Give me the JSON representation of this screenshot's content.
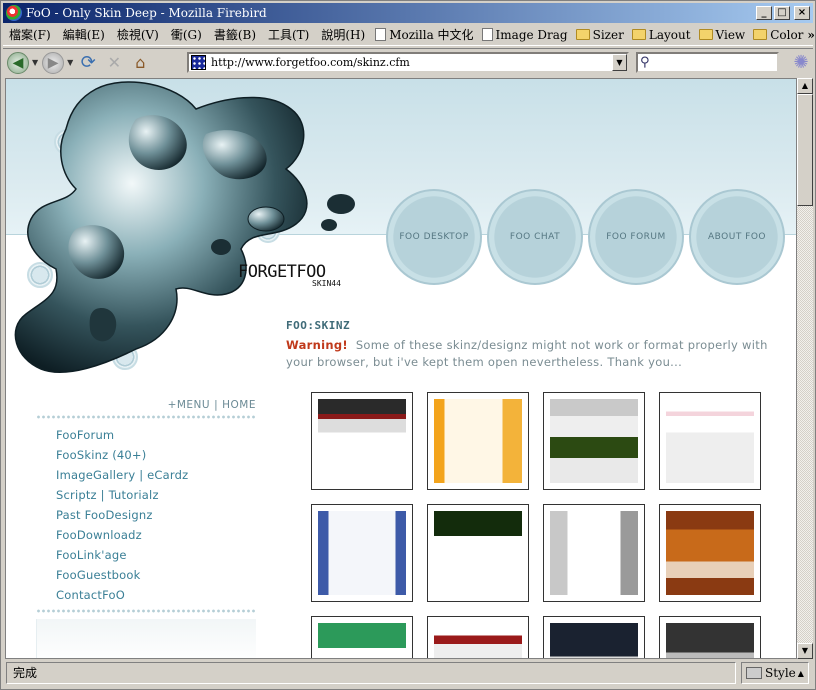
{
  "window": {
    "title": "FoO - Only Skin Deep - Mozilla Firebird",
    "minimize": "_",
    "maximize": "□",
    "close": "×"
  },
  "menu": {
    "items": [
      "檔案(F)",
      "編輯(E)",
      "檢視(V)",
      "衝(G)",
      "書籤(B)",
      "工具(T)",
      "說明(H)"
    ],
    "bookmarks": [
      {
        "label": "Mozilla 中文化",
        "icon": "page-icon"
      },
      {
        "label": "Image Drag",
        "icon": "page-icon"
      },
      {
        "label": "Sizer",
        "icon": "folder-icon"
      },
      {
        "label": "Layout",
        "icon": "folder-icon"
      },
      {
        "label": "View",
        "icon": "folder-icon"
      },
      {
        "label": "Color",
        "icon": "folder-icon"
      }
    ],
    "more": "»"
  },
  "nav": {
    "url": "http://www.forgetfoo.com/skinz.cfm",
    "search_value": ""
  },
  "site": {
    "circle_nav": [
      "FOO DESKTOP",
      "FOO CHAT",
      "FOO FORUM",
      "ABOUT FOO"
    ],
    "logo": "FORGETFOO",
    "logo_sub": "SKIN44",
    "section_title": "FOO:SKINZ",
    "warning_label": "Warning!",
    "warning_text": "Some of these skinz/designz might not work or format properly with your browser, but i've kept them open nevertheless. Thank you...",
    "menu_label": "+MENU",
    "menu_sep": "|",
    "home_label": "HOME",
    "side_links": [
      "FooForum",
      "FooSkinz (40+)",
      "ImageGallery | eCardz",
      "Scriptz | Tutorialz",
      "Past FooDesignz",
      "FooDownloadz",
      "FooLink'age",
      "FooGuestbook",
      "ContactFoO"
    ]
  },
  "status": {
    "text": "完成",
    "style_label": "Style"
  }
}
